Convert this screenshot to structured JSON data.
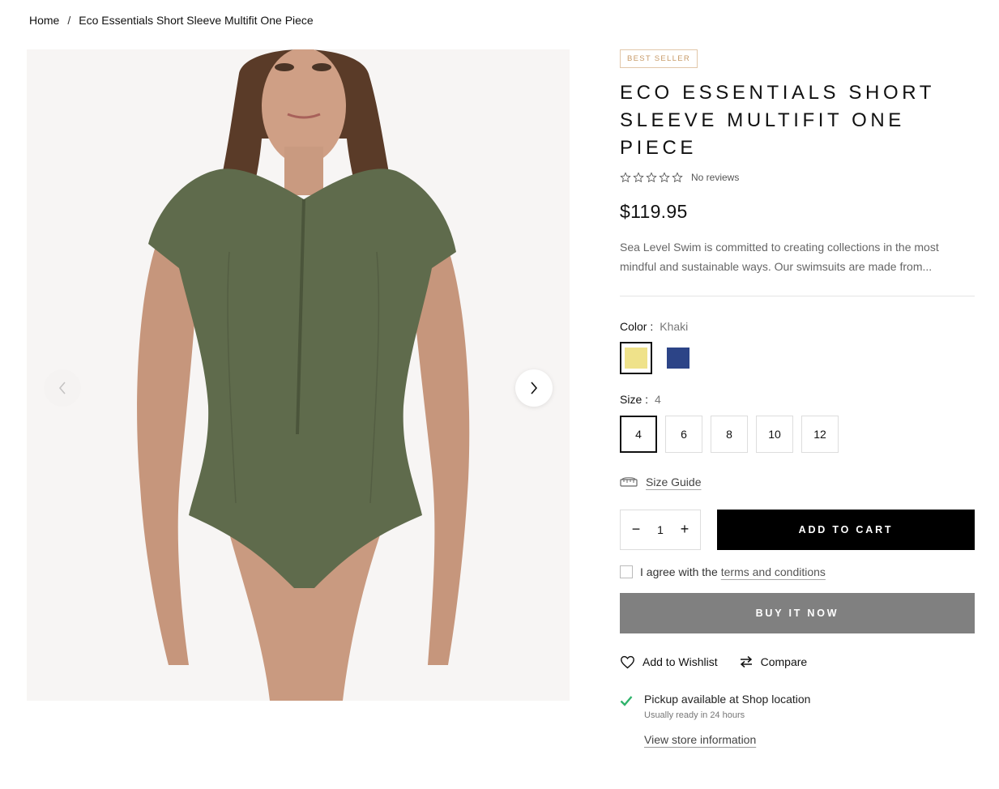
{
  "breadcrumb": {
    "home": "Home",
    "separator": "/",
    "current": "Eco Essentials Short Sleeve Multifit One Piece"
  },
  "gallery": {
    "prev_icon": "chevron-left-icon",
    "next_icon": "chevron-right-icon",
    "image_colors": {
      "background": "#f7f5f4",
      "swimsuit": "#5f6b4c",
      "skin": "#c99a80",
      "hair": "#5a3b28"
    }
  },
  "product": {
    "badge": "BEST SELLER",
    "title": "ECO ESSENTIALS SHORT SLEEVE MULTIFIT ONE PIECE",
    "reviews": "No reviews",
    "rating": 0,
    "rating_max": 5,
    "price": "$119.95",
    "description": "Sea Level Swim is committed to creating collections in the most mindful and sustainable ways. Our swimsuits are made from..."
  },
  "color": {
    "label": "Color :",
    "selected": "Khaki",
    "swatches": [
      {
        "name": "Khaki",
        "hex": "#efe28a",
        "active": true
      },
      {
        "name": "Navy",
        "hex": "#2c4487",
        "active": false
      }
    ]
  },
  "size": {
    "label": "Size :",
    "selected": "4",
    "options": [
      "4",
      "6",
      "8",
      "10",
      "12"
    ]
  },
  "size_guide": {
    "label": "Size Guide",
    "icon": "ruler-icon"
  },
  "cart": {
    "qty_minus": "−",
    "qty_value": "1",
    "qty_plus": "+",
    "add_to_cart": "ADD TO CART"
  },
  "agree": {
    "prefix": "I agree with the",
    "link": "terms and conditions"
  },
  "buy_now": "BUY IT NOW",
  "actions": {
    "wishlist": "Add to Wishlist",
    "compare": "Compare"
  },
  "pickup": {
    "main": "Pickup available at Shop location",
    "sub": "Usually ready in 24 hours",
    "store_link": "View store information",
    "check_color": "#2fb36b"
  }
}
